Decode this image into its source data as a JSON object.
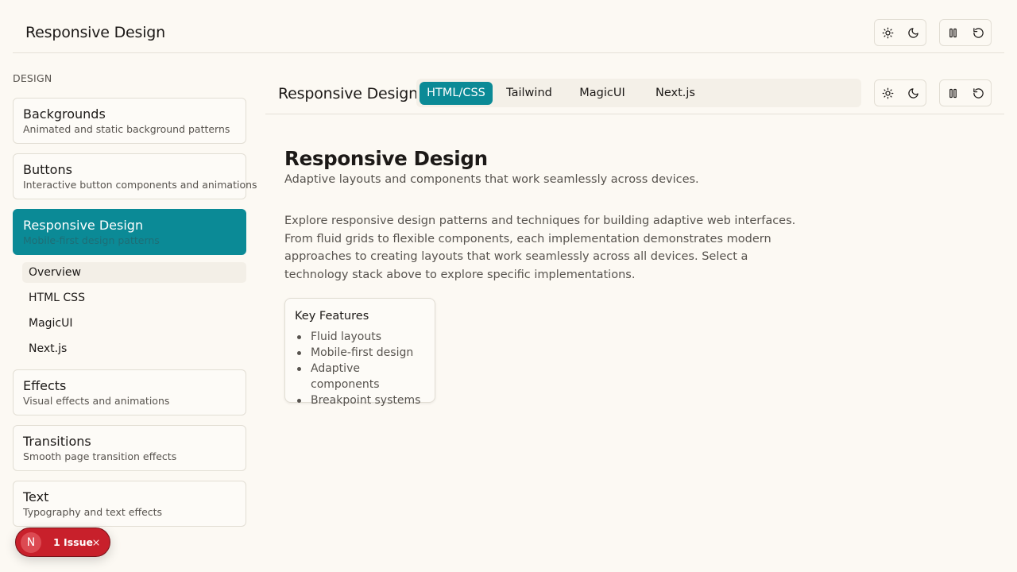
{
  "header": {
    "title": "Responsive Design"
  },
  "icons": {
    "light": "sun-icon",
    "dark": "moon-icon",
    "pause": "pause-icon",
    "reload": "reload-icon",
    "close": "close-icon"
  },
  "sidebar": {
    "section_label": "DESIGN",
    "items": [
      {
        "title": "Backgrounds",
        "description": "Animated and static background patterns"
      },
      {
        "title": "Buttons",
        "description": "Interactive button components and animations"
      },
      {
        "title": "Responsive Design",
        "description": "Mobile-first design patterns",
        "active": true
      },
      {
        "title": "Effects",
        "description": "Visual effects and animations"
      },
      {
        "title": "Transitions",
        "description": "Smooth page transition effects"
      },
      {
        "title": "Text",
        "description": "Typography and text effects"
      }
    ],
    "subitems": [
      {
        "label": "Overview",
        "current": true
      },
      {
        "label": "HTML CSS"
      },
      {
        "label": "MagicUI"
      },
      {
        "label": "Next.js"
      }
    ]
  },
  "content_header": {
    "title": "Responsive Design",
    "tabs": [
      {
        "label": "HTML/CSS",
        "active": true
      },
      {
        "label": "Tailwind"
      },
      {
        "label": "MagicUI"
      },
      {
        "label": "Next.js"
      }
    ]
  },
  "main": {
    "title": "Responsive Design",
    "subtitle": "Adaptive layouts and components that work seamlessly across devices.",
    "body": "Explore responsive design patterns and techniques for building adaptive web interfaces. From fluid grids to flexible components, each implementation demonstrates modern approaches to creating layouts that work seamlessly across all devices. Select a technology stack above to explore specific implementations.",
    "features": {
      "title": "Key Features",
      "items": [
        "Fluid layouts",
        "Mobile-first design",
        "Adaptive components",
        "Breakpoint systems"
      ]
    }
  },
  "issue_badge": {
    "avatar_letter": "N",
    "label": "1 Issue"
  },
  "colors": {
    "accent": "#0b8a96",
    "background": "#fcf9f3",
    "issue": "#c8202b"
  }
}
